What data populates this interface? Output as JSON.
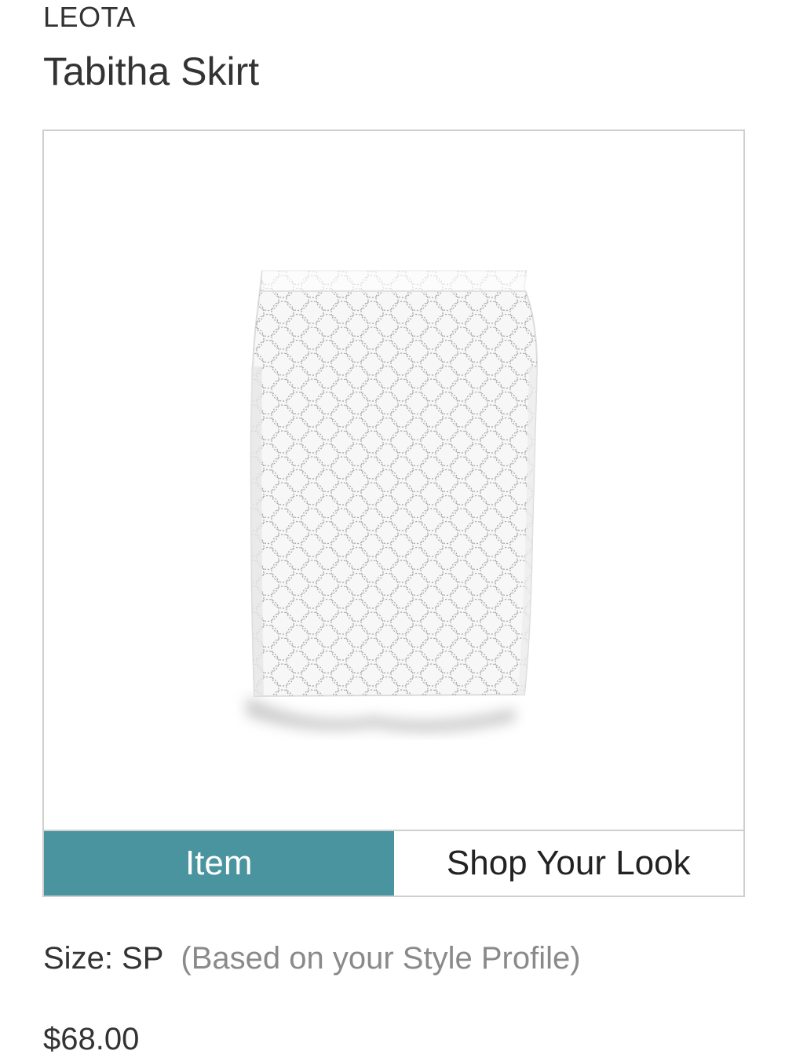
{
  "product": {
    "brand": "LEOTA",
    "name": "Tabitha Skirt",
    "image": {
      "description_icon": "skirt-photo"
    }
  },
  "tabs": [
    {
      "label": "Item",
      "active": true
    },
    {
      "label": "Shop Your Look",
      "active": false
    }
  ],
  "size": {
    "label": "Size: SP",
    "note": "(Based on your Style Profile)"
  },
  "price": "$68.00",
  "colors": {
    "accent": "#4a94a0",
    "text": "#333333",
    "muted": "#8a8a8a",
    "border": "#cfcfcf"
  }
}
